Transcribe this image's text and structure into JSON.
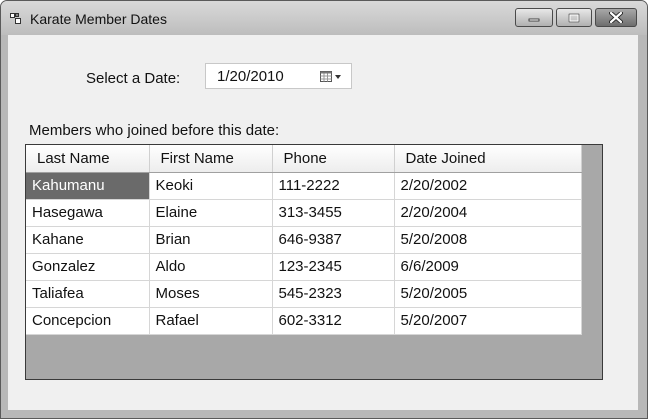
{
  "window": {
    "title": "Karate Member Dates"
  },
  "icons": {
    "app": "app-window-icon",
    "minimize": "minimize-icon",
    "maximize": "maximize-icon",
    "close": "close-icon",
    "calendar": "calendar-dropdown-icon"
  },
  "form": {
    "date_label": "Select a Date:",
    "date_value": "1/20/2010",
    "members_label": "Members who joined before this date:"
  },
  "grid": {
    "columns": [
      "Last Name",
      "First Name",
      "Phone",
      "Date Joined"
    ],
    "rows": [
      [
        "Kahumanu",
        "Keoki",
        "111-2222",
        "2/20/2002"
      ],
      [
        "Hasegawa",
        "Elaine",
        "313-3455",
        "2/20/2004"
      ],
      [
        "Kahane",
        "Brian",
        "646-9387",
        "5/20/2008"
      ],
      [
        "Gonzalez",
        "Aldo",
        "123-2345",
        "6/6/2009"
      ],
      [
        "Taliafea",
        "Moses",
        "545-2323",
        "5/20/2005"
      ],
      [
        "Concepcion",
        "Rafael",
        "602-3312",
        "5/20/2007"
      ]
    ],
    "selected_cell": "Kahumanu"
  }
}
